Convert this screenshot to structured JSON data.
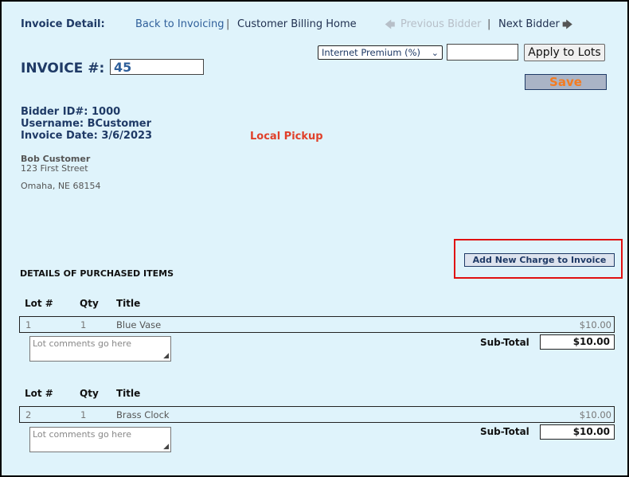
{
  "nav": {
    "title": "Invoice Detail:",
    "back_link": "Back to Invoicing",
    "sep1": "|",
    "billing_link": "Customer Billing Home",
    "prev_label": "Previous Bidder",
    "sep2": "|",
    "next_label": "Next Bidder"
  },
  "invoice": {
    "label": "INVOICE #:",
    "number": "45"
  },
  "charge_controls": {
    "selected_option": "Internet Premium (%)",
    "amount_value": "",
    "apply_label": "Apply to Lots",
    "save_label": "Save"
  },
  "bidder": {
    "id_line": "Bidder ID#: 1000",
    "username_line": "Username: BCustomer",
    "date_line": "Invoice Date: 3/6/2023",
    "pickup": "Local Pickup"
  },
  "address": {
    "name": "Bob Customer",
    "street": "123 First Street",
    "city": "Omaha, NE 68154"
  },
  "add_charge_label": "Add New Charge to Invoice",
  "section_title": "DETAILS OF PURCHASED ITEMS",
  "columns": {
    "lot": "Lot #",
    "qty": "Qty",
    "title": "Title"
  },
  "comments_placeholder": "Lot comments go here",
  "subtotal_label": "Sub-Total",
  "items": [
    {
      "lot": "1",
      "qty": "1",
      "title": "Blue Vase",
      "price": "$10.00",
      "subtotal": "$10.00"
    },
    {
      "lot": "2",
      "qty": "1",
      "title": "Brass Clock",
      "price": "$10.00",
      "subtotal": "$10.00"
    }
  ]
}
